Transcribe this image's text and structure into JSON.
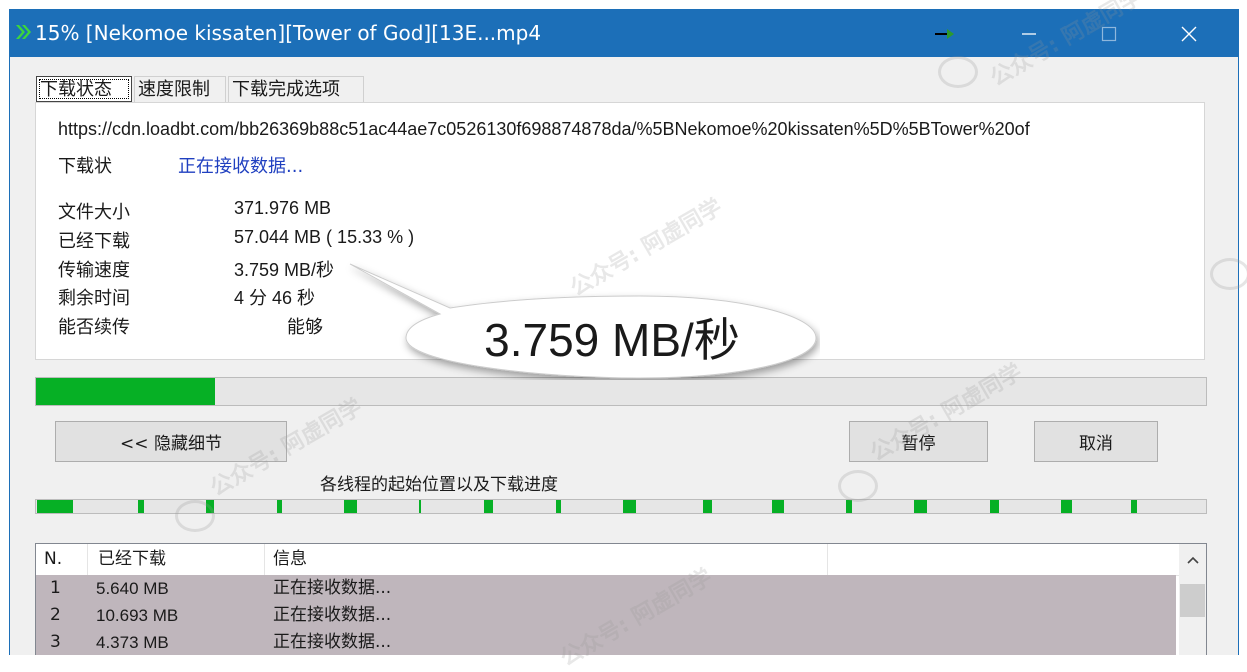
{
  "window": {
    "title": "15% [Nekomoe kissaten][Tower of God][13E...mp4",
    "app_icon": "double-chevron-right-icon"
  },
  "tabs": [
    "下载状态",
    "速度限制",
    "下载完成选项"
  ],
  "info": {
    "url": "https://cdn.loadbt.com/bb26369b88c51ac44ae7c0526130f698874878da/%5BNekomoe%20kissaten%5D%5BTower%20of",
    "status_label": "下载状",
    "status_value": "正在接收数据...",
    "rows": [
      {
        "label": "文件大小",
        "value": "371.976  MB"
      },
      {
        "label": "已经下载",
        "value": "57.044  MB  ( 15.33 % )"
      },
      {
        "label": "传输速度",
        "value": "3.759  MB/秒"
      },
      {
        "label": "剩余时间",
        "value": "4 分 46 秒"
      },
      {
        "label": "能否续传",
        "value": "能够"
      }
    ]
  },
  "callout_text": "3.759  MB/秒",
  "progress": {
    "percent": 15.33
  },
  "buttons": {
    "hide_details": "<< 隐藏细节",
    "pause": "暂停",
    "cancel": "取消"
  },
  "threads": {
    "label": "各线程的起始位置以及下载进度"
  },
  "list": {
    "columns": [
      "N.",
      "已经下载",
      "信息"
    ],
    "rows": [
      {
        "n": "1",
        "downloaded": "5.640  MB",
        "info": "正在接收数据..."
      },
      {
        "n": "2",
        "downloaded": "10.693  MB",
        "info": "正在接收数据..."
      },
      {
        "n": "3",
        "downloaded": "4.373  MB",
        "info": "正在接收数据..."
      }
    ]
  },
  "watermark": "公众号: 阿虚同学",
  "colors": {
    "titlebar": "#1c6fb8",
    "progress_green": "#06b025",
    "list_row_bg": "#bfb6bc",
    "status_blue": "#2040c0"
  }
}
